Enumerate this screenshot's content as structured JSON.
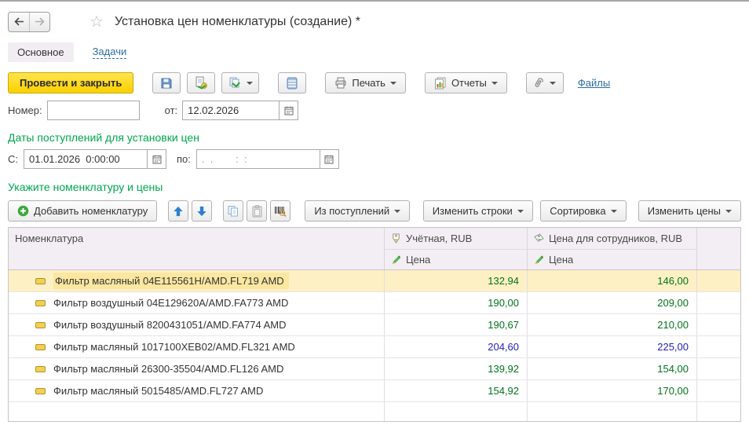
{
  "window": {
    "title": "Установка цен номенклатуры (создание) *"
  },
  "tabs": [
    {
      "label": "Основное",
      "active": true
    },
    {
      "label": "Задачи",
      "active": false
    }
  ],
  "toolbar": {
    "post_and_close": "Провести и закрыть",
    "print_label": "Печать",
    "reports_label": "Отчеты",
    "files_link": "Файлы"
  },
  "header_fields": {
    "number_label": "Номер:",
    "number_value": "",
    "date_label": "от:",
    "date_value": "12.02.2026"
  },
  "dates_section": {
    "title": "Даты поступлений для установки цен",
    "from_label": "С:",
    "from_value": "01.01.2026  0:00:00",
    "to_label": "по:",
    "to_mask": ".  .        :  :"
  },
  "items_section": {
    "title": "Укажите номенклатуру и цены",
    "add_button": "Добавить номенклатуру",
    "from_receipts_button": "Из поступлений",
    "edit_rows_button": "Изменить строки",
    "sorting_button": "Сортировка",
    "edit_prices_button": "Изменить цены"
  },
  "table": {
    "columns": {
      "name": "Номенклатура",
      "price1": "Учётная, RUB",
      "price2": "Цена для сотрудников, RUB",
      "sub_price": "Цена"
    },
    "rows": [
      {
        "name": "Фильтр масляный 04E115561H/AMD.FL719 AMD",
        "price1": "132,94",
        "price2": "146,00",
        "selected": true,
        "value_color": "green"
      },
      {
        "name": "Фильтр воздушный 04E129620A/AMD.FA773 AMD",
        "price1": "190,00",
        "price2": "209,00",
        "selected": false,
        "value_color": "green"
      },
      {
        "name": "Фильтр воздушный 8200431051/AMD.FA774 AMD",
        "price1": "190,67",
        "price2": "210,00",
        "selected": false,
        "value_color": "green"
      },
      {
        "name": "Фильтр масляный 1017100XEB02/AMD.FL321 AMD",
        "price1": "204,60",
        "price2": "225,00",
        "selected": false,
        "value_color": "blue"
      },
      {
        "name": "Фильтр масляный 26300-35504/AMD.FL126 AMD",
        "price1": "139,92",
        "price2": "154,00",
        "selected": false,
        "value_color": "green"
      },
      {
        "name": "Фильтр масляный 5015485/AMD.FL727 AMD",
        "price1": "154,92",
        "price2": "170,00",
        "selected": false,
        "value_color": "green"
      }
    ]
  },
  "icons": {
    "back": "left-arrow",
    "forward": "right-arrow",
    "favorite": "star-outline",
    "save": "floppy-disk",
    "post": "document-with-coins-arrow",
    "create_based_on": "copy-with-green-arrow",
    "register_records": "blue-list",
    "print": "printer",
    "reports": "bar-chart-sheet",
    "attach": "paperclip",
    "calendar": "calendar-grid",
    "add": "green-plus-circle",
    "move_up": "blue-arrow-up",
    "move_down": "blue-arrow-down",
    "copy": "two-sheets",
    "paste": "clipboard",
    "barcode": "barcode-scanner",
    "price_tag": "tag",
    "edit": "green-pencil",
    "row_marker": "yellow-item-dash"
  },
  "colors": {
    "section_green": "#00a651",
    "link_blue": "#2d6da3",
    "price_green": "#00731c",
    "price_blue": "#2222bb",
    "selection_yellow": "#fdf0c5",
    "button_yellow": "#fad000",
    "header_bg": "#f3eef3"
  }
}
